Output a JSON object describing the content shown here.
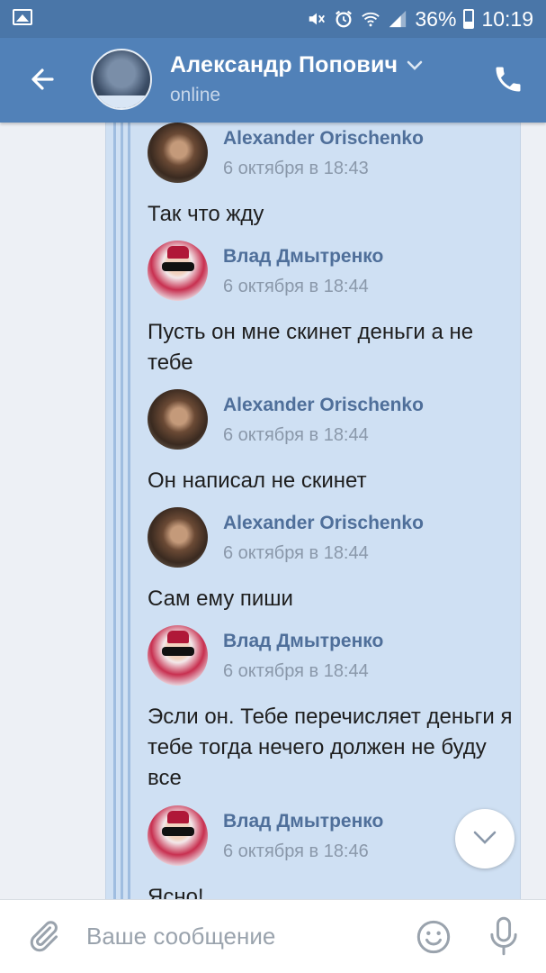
{
  "status_bar": {
    "battery": "36%",
    "time": "10:19",
    "icons": [
      "image-icon",
      "mute-icon",
      "alarm-icon",
      "wifi-icon",
      "signal-icon",
      "battery-icon"
    ]
  },
  "header": {
    "name": "Александр Попович",
    "status": "online",
    "icons": [
      "back-arrow-icon",
      "chevron-down-icon",
      "phone-icon"
    ]
  },
  "messages": [
    {
      "author": "Alexander Orischenko",
      "date": "6 октября в 18:43",
      "text": "Так что жду",
      "avatar": "avatar-alexander"
    },
    {
      "author": "Влад Дмытренко",
      "date": "6 октября в 18:44",
      "text": "Пусть он мне скинет деньги а не тебе",
      "avatar": "avatar-vlad"
    },
    {
      "author": "Alexander Orischenko",
      "date": "6 октября в 18:44",
      "text": "Он написал не скинет",
      "avatar": "avatar-alexander"
    },
    {
      "author": "Alexander Orischenko",
      "date": "6 октября в 18:44",
      "text": "Сам ему пиши",
      "avatar": "avatar-alexander"
    },
    {
      "author": "Влад Дмытренко",
      "date": "6 октября в 18:44",
      "text": "Эсли он. Тебе перечисляет деньги я тебе тогда нечего должен не буду все",
      "avatar": "avatar-vlad"
    },
    {
      "author": "Влад Дмытренко",
      "date": "6 октября в 18:46",
      "text": "Ясно!",
      "avatar": "avatar-vlad"
    }
  ],
  "composer": {
    "placeholder": "Ваше сообщение",
    "icons": [
      "attach-icon",
      "emoji-icon",
      "mic-icon"
    ]
  },
  "colors": {
    "header": "#5181b8",
    "status_bar": "#4a76a8",
    "bubble": "#cfe0f3",
    "author_name": "#4f6f9a"
  }
}
